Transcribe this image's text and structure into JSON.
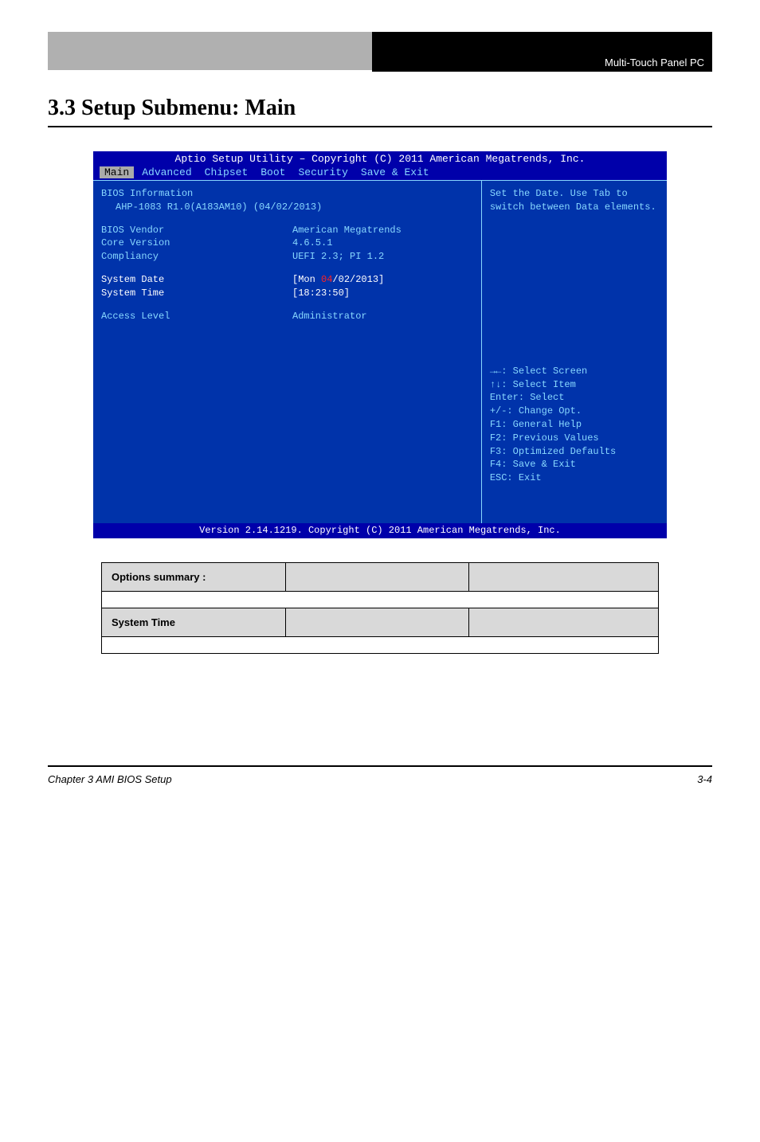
{
  "header": {
    "left_label": "",
    "right_label": "Multi-Touch Panel PC"
  },
  "section": {
    "title": "3.3 Setup Submenu: Main",
    "subtext": ""
  },
  "bios": {
    "titlebar": "Aptio Setup Utility – Copyright (C) 2011 American Megatrends, Inc.",
    "menu": [
      "Main",
      "Advanced",
      "Chipset",
      "Boot",
      "Security",
      "Save & Exit"
    ],
    "active_menu": "Main",
    "info_heading": "BIOS Information",
    "info_sub": "AHP-1083 R1.0(A183AM10) (04/02/2013)",
    "rows": [
      {
        "label": "BIOS Vendor",
        "value": "American Megatrends"
      },
      {
        "label": "Core Version",
        "value": "4.6.5.1"
      },
      {
        "label": "Compliancy",
        "value": "UEFI 2.3; PI 1.2"
      }
    ],
    "system_date_label": "System Date",
    "system_date_value_prefix": "[Mon ",
    "system_date_hl": "04",
    "system_date_value_suffix": "/02/2013]",
    "system_time_label": "System Time",
    "system_time_value": "[18:23:50]",
    "access_label": "Access Level",
    "access_value": "Administrator",
    "help_top": "Set the Date. Use Tab to switch between Data elements.",
    "help_bottom": [
      "→←: Select Screen",
      "↑↓: Select Item",
      "Enter: Select",
      "+/-: Change Opt.",
      "F1: General Help",
      "F2: Previous Values",
      "F3: Optimized Defaults",
      "F4: Save & Exit",
      "ESC: Exit"
    ],
    "footer": "Version 2.14.1219. Copyright (C) 2011 American Megatrends, Inc."
  },
  "tables": [
    {
      "headers": [
        "Options summary :",
        "",
        ""
      ],
      "desc": ""
    },
    {
      "headers": [
        "System Time",
        "",
        ""
      ],
      "desc": ""
    }
  ],
  "footer": {
    "left_chapter": "Chapter 3 AMI BIOS Setup",
    "right_page": "3-4"
  }
}
